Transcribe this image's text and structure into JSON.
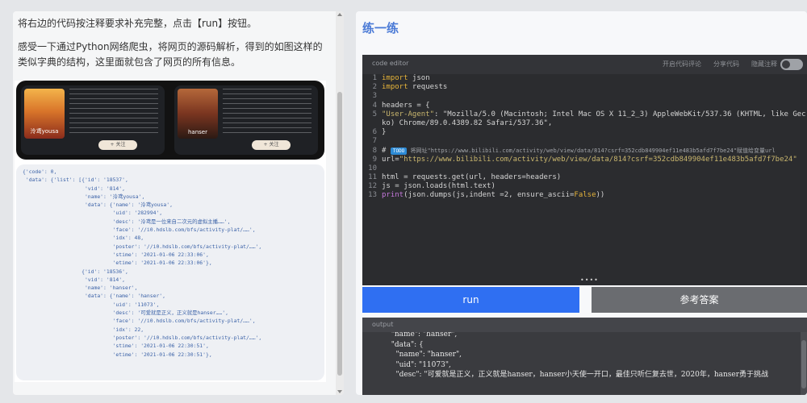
{
  "instructions": {
    "p1": "将右边的代码按注释要求补充完整，点击【run】按钮。",
    "p2": "感受一下通过Python网络爬虫，将网页的源码解析，得到的如图这样的类似字典的结构，这里面就包含了网页的所有信息。"
  },
  "figure": {
    "card1": {
      "name": "泠鸢yousa",
      "follow": "+ 关注"
    },
    "card2": {
      "name": "hanser",
      "follow": "+ 关注"
    },
    "json_lines": [
      "{'code': 0,",
      " 'data': {'list': [{'id': '18537',",
      "                    'vid': '814',",
      "                    'name': '泠鸢yousa',",
      "                    'data': {'name': '泠鸢yousa',",
      "                             'uid': '282994',",
      "                             'desc': '泠鸢是一位来自二次元的虚拟主播……',",
      "                             'face': '//i0.hdslb.com/bfs/activity-plat/……',",
      "                             'idx': 48,",
      "                             'poster': '//i0.hdslb.com/bfs/activity-plat/……',",
      "                             'stime': '2021-01-06 22:33:06',",
      "                             'etime': '2021-01-06 22:33:06'},",
      "                   {'id': '18536',",
      "                    'vid': '814',",
      "                    'name': 'hanser',",
      "                    'data': {'name': 'hanser',",
      "                             'uid': '11073',",
      "                             'desc': '可爱就是正义，正义就是hanser……',",
      "                             'face': '//i0.hdslb.com/bfs/activity-plat/……',",
      "                             'idx': 22,",
      "                             'poster': '//i0.hdslb.com/bfs/activity-plat/……',",
      "                             'stime': '2021-01-06 22:30:51',",
      "                             'etime': '2021-01-06 22:30:51'},"
    ]
  },
  "practice": {
    "title": "练一练"
  },
  "editor": {
    "title": "code editor",
    "comments_label": "开启代码评论",
    "share_label": "分享代码",
    "hide_label": "隐藏注释",
    "todo_label": "TODO",
    "todo_comment": "将网址\"https://www.bilibili.com/activity/web/view/data/814?csrf=352cdb849904ef11e483b5afd7f7be24\"赋值给变量url"
  },
  "code_lines": [
    {
      "n": "1",
      "text": "import json"
    },
    {
      "n": "2",
      "text": "import requests"
    },
    {
      "n": "3",
      "text": ""
    },
    {
      "n": "4",
      "text": "headers = {"
    },
    {
      "n": "5",
      "text": "\"User-Agent\": \"Mozilla/5.0 (Macintosh; Intel Mac OS X 11_2_3) AppleWebKit/537.36 (KHTML, like Gec"
    },
    {
      "n": "",
      "text": "ko) Chrome/89.0.4389.82 Safari/537.36\","
    },
    {
      "n": "6",
      "text": "}"
    },
    {
      "n": "7",
      "text": ""
    },
    {
      "n": "8",
      "text": "# "
    },
    {
      "n": "9",
      "text": "url=\"https://www.bilibili.com/activity/web/view/data/814?csrf=352cdb849904ef11e483b5afd7f7be24\""
    },
    {
      "n": "10",
      "text": ""
    },
    {
      "n": "11",
      "text": "html = requests.get(url, headers=headers)"
    },
    {
      "n": "12",
      "text": "js = json.loads(html.text)"
    },
    {
      "n": "13",
      "text": "print(json.dumps(js,indent =2, ensure_ascii=False))"
    }
  ],
  "buttons": {
    "run": "run",
    "reference": "参考答案"
  },
  "output": {
    "title": "output",
    "lines": [
      "  \"name\": \"hanser\",",
      "  \"data\": {",
      "    \"name\": \"hanser\",",
      "    \"uid\": \"11073\",",
      "    \"desc\": \"可爱就是正义，正义就是hanser，hanser小天使一开口，最佳只听仨复去世，2020年，hanser勇于挑战"
    ]
  },
  "colors": {
    "accent": "#2f6ff2",
    "title": "#4a7ad6",
    "editor_bg": "#2b2c2f"
  }
}
